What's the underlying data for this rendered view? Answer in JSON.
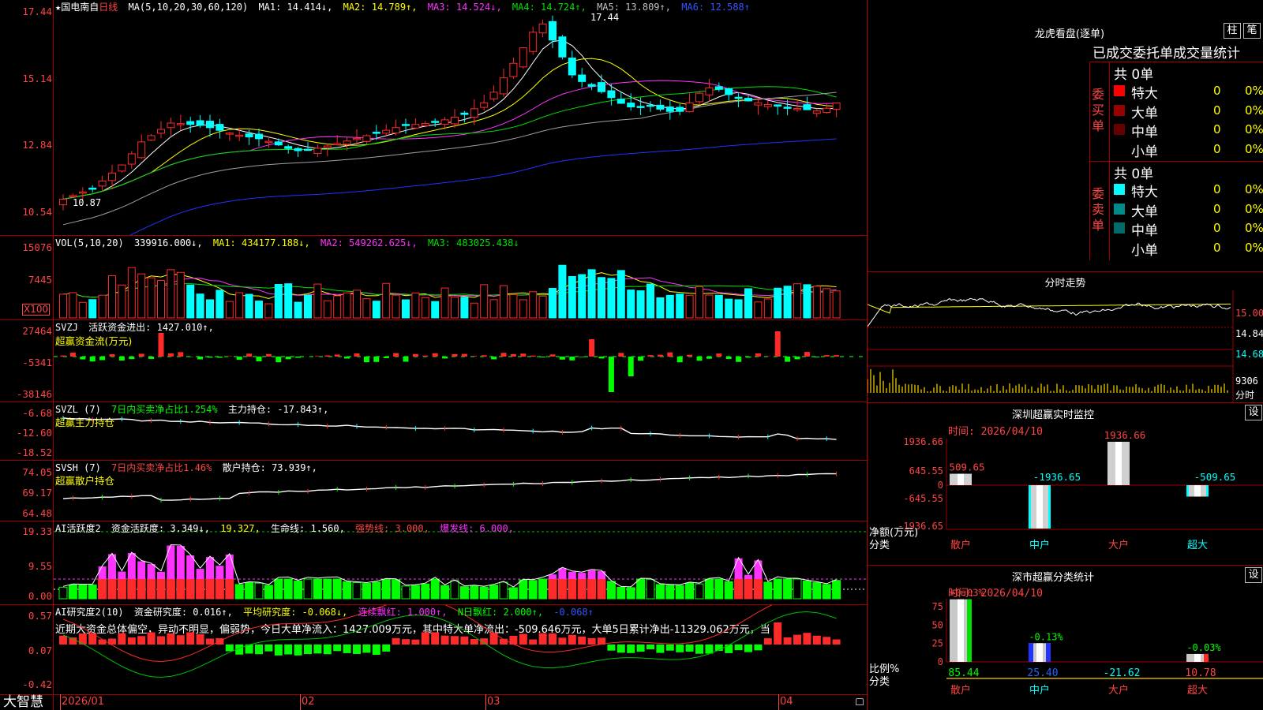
{
  "app": {
    "logo": "大智慧",
    "stock_name": "★国电南自",
    "period": "日线"
  },
  "colors": {
    "bg": "#000000",
    "border": "#a00000",
    "axis_red": "#ff4444",
    "up": "#ff2a2a",
    "down": "#00ffff",
    "ma1": "#ffffff",
    "ma2": "#ffff00",
    "ma3": "#ff33ff",
    "ma4": "#00e000",
    "ma5": "#a0a0a0",
    "ma6": "#2233ff",
    "green": "#00ff00"
  },
  "price_panel": {
    "header": {
      "ma_label": "MA(5,10,20,30,60,120)",
      "ma1": "MA1: 14.414↓,",
      "ma2": "MA2: 14.789↑,",
      "ma3": "MA3: 14.524↓,",
      "ma4": "MA4: 14.724↑,",
      "ma5": "MA5: 13.809↑,",
      "ma6": "MA6: 12.588↑"
    },
    "y_labels": [
      "17.44",
      "15.14",
      "12.84",
      "10.54"
    ],
    "high_label": "17.44",
    "low_label": "10.87"
  },
  "vol_panel": {
    "header": {
      "name": "VOL(5,10,20)",
      "value": "339916.000↓,",
      "ma1": "MA1: 434177.188↓,",
      "ma2": "MA2: 549262.625↓,",
      "ma3": "MA3: 483025.438↓"
    },
    "y_labels": [
      "15076",
      "7445"
    ],
    "unit": "X100"
  },
  "svzj_panel": {
    "header": {
      "name": "SVZJ",
      "value": "活跃资金进出: 1427.010↑,",
      "sub": "超赢资金流(万元)"
    },
    "y_labels": [
      "27464",
      "-5341",
      "-38146"
    ]
  },
  "svzl_panel": {
    "header": {
      "name": "SVZL (7)",
      "ratio": "7日内买卖净占比1.254%",
      "value": "主力持仓: -17.843↑,",
      "sub": "超赢主力持仓"
    },
    "y_labels": [
      "-6.68",
      "-12.60",
      "-18.52"
    ]
  },
  "svsh_panel": {
    "header": {
      "name": "SVSH (7)",
      "ratio": "7日内买卖净占比1.46%",
      "value": "散户持仓: 73.939↑,",
      "sub": "超赢散户持仓"
    },
    "y_labels": [
      "74.05",
      "69.17",
      "64.48"
    ]
  },
  "ai_active_panel": {
    "header": {
      "name": "AI活跃度2",
      "v1": "资金活跃度: 3.349↓,",
      "v2": "19.327,",
      "v3": "生命线: 1.560,",
      "v4": "强势线: 3.000,",
      "v5": "爆发线: 6.000,"
    },
    "y_labels": [
      "19.33",
      "9.55",
      "0.00"
    ]
  },
  "ai_research_panel": {
    "header": {
      "name": "AI研究度2(10)",
      "v1": "资金研究度: 0.016↑,",
      "v2": "平均研究度: -0.068↓,",
      "v3": "连续飘红: 1.000↑,",
      "v4": "N日飘红: 2.000↑,",
      "v5": "-0.068↑"
    },
    "commentary": "近期大资金总体偏空，异动不明显，偏弱势，今日大单净流入：1427.009万元，其中特大单净流出：-509.646万元，大单5日累计净出-11329.062万元，当",
    "y_labels": [
      "0.57",
      "0.07",
      "-0.42"
    ]
  },
  "x_axis": {
    "labels": [
      "2026/01",
      "02",
      "03",
      "04"
    ]
  },
  "right": {
    "dragon": {
      "title": "龙虎看盘(逐单)",
      "btn1": "柱",
      "btn2": "笔",
      "subtitle": "已成交委托单成交量统计",
      "buy_side": "委买单",
      "sell_side": "委卖单",
      "buy_total": "共 0单",
      "sell_total": "共 0单",
      "buy_rows": [
        {
          "label": "特大",
          "count": "0",
          "pct": "0%"
        },
        {
          "label": "大单",
          "count": "0",
          "pct": "0%"
        },
        {
          "label": "中单",
          "count": "0",
          "pct": "0%"
        },
        {
          "label": "小单",
          "count": "0",
          "pct": "0%"
        }
      ],
      "sell_rows": [
        {
          "label": "特大",
          "count": "0",
          "pct": "0%"
        },
        {
          "label": "大单",
          "count": "0",
          "pct": "0%"
        },
        {
          "label": "中单",
          "count": "0",
          "pct": "0%"
        },
        {
          "label": "小单",
          "count": "0",
          "pct": "0%"
        }
      ]
    },
    "intraday": {
      "title": "分时走势",
      "y_labels": [
        "15.00",
        "14.84",
        "14.68"
      ],
      "vol_label": "9306",
      "vol_unit": "分时"
    },
    "sz_monitor": {
      "title": "深圳超赢实时监控",
      "btn": "设",
      "time": "时间: 2026/04/10",
      "y_labels": [
        "1936.66",
        "645.55",
        "0",
        "-645.55",
        "-1936.65"
      ],
      "y_unit": "净额(万元)",
      "x_unit": "分类",
      "chart_data": {
        "type": "bar",
        "categories": [
          "散户",
          "中户",
          "大户",
          "超大"
        ],
        "values": [
          509.65,
          -1936.65,
          1936.66,
          -509.65
        ],
        "labels": [
          "509.65",
          "-1936.65",
          "1936.66",
          "-509.65"
        ],
        "ylim": [
          -1936.65,
          1936.66
        ]
      }
    },
    "sz_class": {
      "title": "深市超赢分类统计",
      "btn": "设",
      "time": "时间: 2026/04/10",
      "y_labels": [
        "75",
        "50",
        "25",
        "0"
      ],
      "y_unit": "比例%",
      "x_unit": "分类",
      "chart_data": {
        "type": "bar",
        "categories": [
          "散户",
          "中户",
          "大户",
          "超大"
        ],
        "values": [
          85.44,
          25.4,
          -21.62,
          10.78
        ],
        "bar_labels": [
          "+0.03%",
          "-0.13%",
          "",
          "-0.03%"
        ],
        "footer_values": [
          "85.44",
          "25.40",
          "-21.62",
          "10.78"
        ],
        "ylim": [
          0,
          85
        ]
      }
    }
  }
}
